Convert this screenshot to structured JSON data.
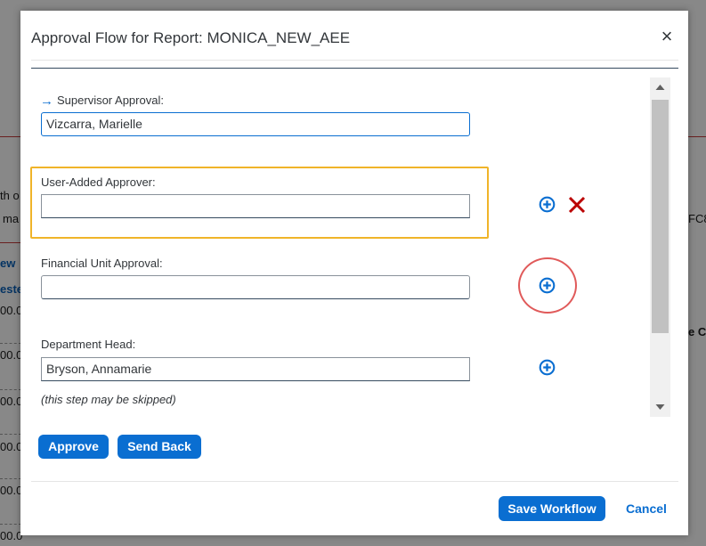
{
  "background": {
    "fragments": [
      "th o",
      "ma",
      "FC8",
      "ew",
      "este",
      "00.0",
      "00.0",
      "00.0",
      "00.0",
      "00.0",
      "00.0",
      "e Co"
    ]
  },
  "dialog": {
    "title": "Approval Flow for Report: MONICA_NEW_AEE",
    "close_symbol": "×"
  },
  "steps": {
    "supervisor": {
      "label": "Supervisor Approval:",
      "value": "Vizcarra, Marielle"
    },
    "user_added": {
      "label": "User-Added Approver:",
      "value": ""
    },
    "financial_unit": {
      "label": "Financial Unit Approval:",
      "value": ""
    },
    "department_head": {
      "label": "Department Head:",
      "value": "Bryson, Annamarie",
      "hint": "(this step may be skipped)"
    }
  },
  "actions": {
    "approve_label": "Approve",
    "send_back_label": "Send Back",
    "save_workflow_label": "Save Workflow",
    "cancel_label": "Cancel"
  },
  "icons": {
    "arrow": "arrow-right-icon",
    "add": "add-circle-icon",
    "delete": "delete-x-icon",
    "close": "close-icon"
  },
  "colors": {
    "accent": "#0a6ed1",
    "delete": "#bb0000",
    "highlight_box": "#f0b429",
    "annotation_circle": "#e05a5a"
  }
}
